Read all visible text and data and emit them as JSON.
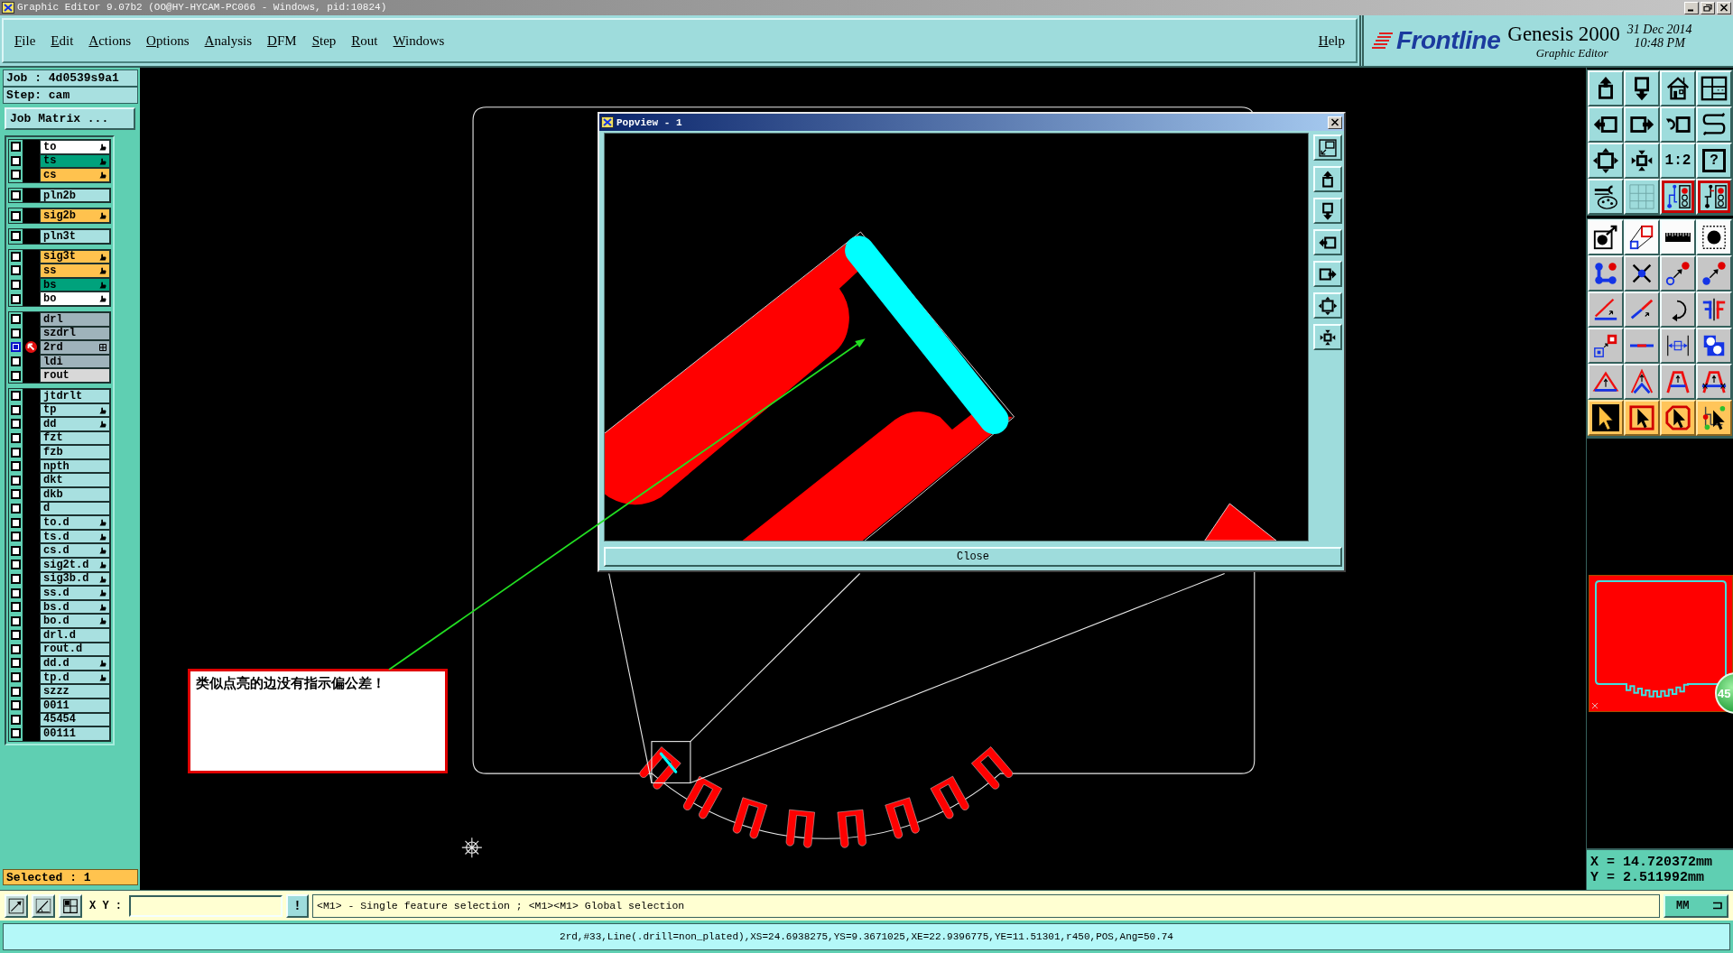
{
  "window": {
    "title": "Graphic Editor 9.07b2 (OO@HY-HYCAM-PC066 - Windows, pid:10824)"
  },
  "menu": {
    "items": [
      "File",
      "Edit",
      "Actions",
      "Options",
      "Analysis",
      "DFM",
      "Step",
      "Rout",
      "Windows"
    ],
    "help": "Help"
  },
  "brand": {
    "logo": "Frontline",
    "product": "Genesis 2000",
    "subtitle": "Graphic Editor",
    "date": "31 Dec 2014",
    "time": "10:48 PM"
  },
  "job": {
    "job": "Job : 4d0539s9a1",
    "step": "Step: cam",
    "matrix_button": "Job Matrix ..."
  },
  "layers": [
    {
      "rows": [
        {
          "name": "to",
          "color": "#ffffff",
          "displayed": false,
          "work": false,
          "flag": true,
          "selection": false
        },
        {
          "name": "ts",
          "color": "#00a27c",
          "displayed": false,
          "work": false,
          "flag": true,
          "selection": false
        },
        {
          "name": "cs",
          "color": "#ffc24e",
          "displayed": false,
          "work": false,
          "flag": true,
          "selection": false
        }
      ]
    },
    {
      "rows": [
        {
          "name": "pln2b",
          "color": "#a8e0e0",
          "displayed": false,
          "work": false,
          "flag": false,
          "selection": false
        }
      ]
    },
    {
      "rows": [
        {
          "name": "sig2b",
          "color": "#ffc24e",
          "displayed": false,
          "work": false,
          "flag": true,
          "selection": false
        }
      ]
    },
    {
      "rows": [
        {
          "name": "pln3t",
          "color": "#a8e0e0",
          "displayed": false,
          "work": false,
          "flag": false,
          "selection": false
        }
      ]
    },
    {
      "rows": [
        {
          "name": "sig3t",
          "color": "#ffc24e",
          "displayed": false,
          "work": false,
          "flag": true,
          "selection": false
        },
        {
          "name": "ss",
          "color": "#ffc24e",
          "displayed": false,
          "work": false,
          "flag": true,
          "selection": false
        },
        {
          "name": "bs",
          "color": "#00a27c",
          "displayed": false,
          "work": false,
          "flag": true,
          "selection": false
        },
        {
          "name": "bo",
          "color": "#ffffff",
          "displayed": false,
          "work": false,
          "flag": true,
          "selection": false
        }
      ]
    },
    {
      "rows": [
        {
          "name": "drl",
          "color": "#9fb3bb",
          "displayed": false,
          "work": false,
          "flag": false,
          "selection": false
        },
        {
          "name": "szdrl",
          "color": "#9fb3bb",
          "displayed": false,
          "work": false,
          "flag": false,
          "selection": false
        },
        {
          "name": "2rd",
          "color": "#9fb3bb",
          "displayed": true,
          "work": true,
          "flag": false,
          "selection": true
        },
        {
          "name": "ldi",
          "color": "#9fb3bb",
          "displayed": false,
          "work": false,
          "flag": false,
          "selection": false
        },
        {
          "name": "rout",
          "color": "#d8d8d8",
          "displayed": false,
          "work": false,
          "flag": false,
          "selection": false
        }
      ]
    },
    {
      "rows": [
        {
          "name": "jtdrlt",
          "color": "#a8e0e0",
          "displayed": false,
          "work": false,
          "flag": false,
          "selection": false
        },
        {
          "name": "tp",
          "color": "#a8e0e0",
          "displayed": false,
          "work": false,
          "flag": true,
          "selection": false
        },
        {
          "name": "dd",
          "color": "#a8e0e0",
          "displayed": false,
          "work": false,
          "flag": true,
          "selection": false
        },
        {
          "name": "fzt",
          "color": "#a8e0e0",
          "displayed": false,
          "work": false,
          "flag": false,
          "selection": false
        },
        {
          "name": "fzb",
          "color": "#a8e0e0",
          "displayed": false,
          "work": false,
          "flag": false,
          "selection": false
        },
        {
          "name": "npth",
          "color": "#a8e0e0",
          "displayed": false,
          "work": false,
          "flag": false,
          "selection": false
        },
        {
          "name": "dkt",
          "color": "#a8e0e0",
          "displayed": false,
          "work": false,
          "flag": false,
          "selection": false
        },
        {
          "name": "dkb",
          "color": "#a8e0e0",
          "displayed": false,
          "work": false,
          "flag": false,
          "selection": false
        },
        {
          "name": "d",
          "color": "#a8e0e0",
          "displayed": false,
          "work": false,
          "flag": false,
          "selection": false
        },
        {
          "name": "to.d",
          "color": "#a8e0e0",
          "displayed": false,
          "work": false,
          "flag": true,
          "selection": false
        },
        {
          "name": "ts.d",
          "color": "#a8e0e0",
          "displayed": false,
          "work": false,
          "flag": true,
          "selection": false
        },
        {
          "name": "cs.d",
          "color": "#a8e0e0",
          "displayed": false,
          "work": false,
          "flag": true,
          "selection": false
        },
        {
          "name": "sig2t.d",
          "color": "#a8e0e0",
          "displayed": false,
          "work": false,
          "flag": true,
          "selection": false
        },
        {
          "name": "sig3b.d",
          "color": "#a8e0e0",
          "displayed": false,
          "work": false,
          "flag": true,
          "selection": false
        },
        {
          "name": "ss.d",
          "color": "#a8e0e0",
          "displayed": false,
          "work": false,
          "flag": true,
          "selection": false
        },
        {
          "name": "bs.d",
          "color": "#a8e0e0",
          "displayed": false,
          "work": false,
          "flag": true,
          "selection": false
        },
        {
          "name": "bo.d",
          "color": "#a8e0e0",
          "displayed": false,
          "work": false,
          "flag": true,
          "selection": false
        },
        {
          "name": "drl.d",
          "color": "#a8e0e0",
          "displayed": false,
          "work": false,
          "flag": false,
          "selection": false
        },
        {
          "name": "rout.d",
          "color": "#a8e0e0",
          "displayed": false,
          "work": false,
          "flag": false,
          "selection": false
        },
        {
          "name": "dd.d",
          "color": "#a8e0e0",
          "displayed": false,
          "work": false,
          "flag": true,
          "selection": false
        },
        {
          "name": "tp.d",
          "color": "#a8e0e0",
          "displayed": false,
          "work": false,
          "flag": true,
          "selection": false
        },
        {
          "name": "szzz",
          "color": "#a8e0e0",
          "displayed": false,
          "work": false,
          "flag": false,
          "selection": false
        },
        {
          "name": "0011",
          "color": "#a8e0e0",
          "displayed": false,
          "work": false,
          "flag": false,
          "selection": false
        },
        {
          "name": "45454",
          "color": "#a8e0e0",
          "displayed": false,
          "work": false,
          "flag": false,
          "selection": false
        },
        {
          "name": "00111",
          "color": "#a8e0e0",
          "displayed": false,
          "work": false,
          "flag": false,
          "selection": false
        }
      ]
    }
  ],
  "selected_count": "Selected : 1",
  "canvas": {
    "note": "类似点亮的边没有指示偏公差！"
  },
  "popview": {
    "title": "Popview - 1",
    "close_button": "Close"
  },
  "toolbar": {
    "ratio_button": "1:2",
    "help_button": "?",
    "toggles": [
      {
        "on": true
      },
      {
        "on": true
      }
    ],
    "select_modes": [
      {
        "selected": true
      },
      {
        "selected": false
      },
      {
        "selected": false
      },
      {
        "selected": false
      }
    ]
  },
  "minimap": {
    "badge": "45"
  },
  "coordinates": {
    "x": "X = 14.720372mm",
    "y": "Y = 2.511992mm"
  },
  "command_bar": {
    "label": "X Y :",
    "alert_button": "!",
    "message": "<M1> - Single feature selection ; <M1><M1> Global selection",
    "units": "MM"
  },
  "status_bar": "2rd,#33,Line(.drill=non_plated),XS=24.6938275,YS=9.3671025,XE=22.9396775,YE=11.51301,r450,POS,Ang=50.74"
}
